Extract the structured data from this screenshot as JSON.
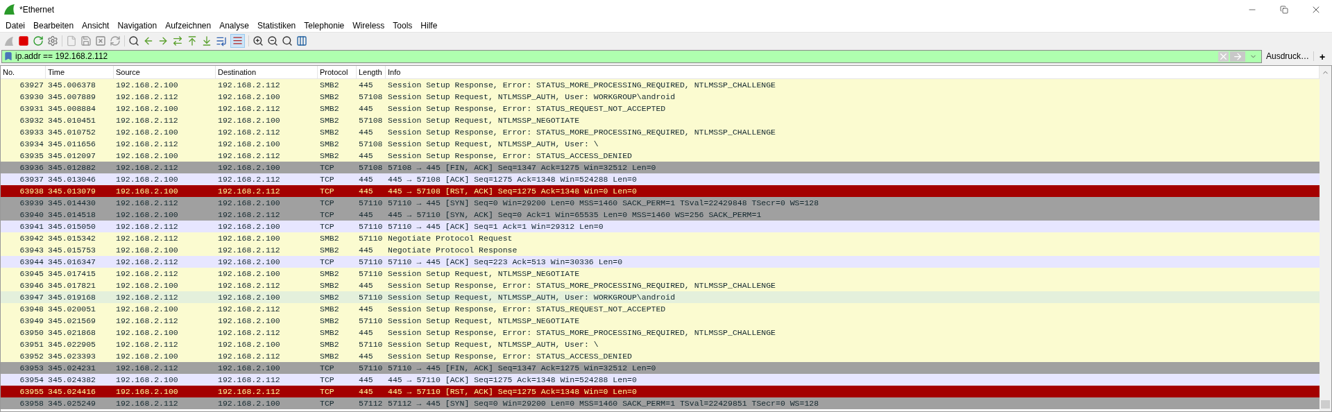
{
  "window": {
    "title": "*Ethernet"
  },
  "menu": [
    "Datei",
    "Bearbeiten",
    "Ansicht",
    "Navigation",
    "Aufzeichnen",
    "Analyse",
    "Statistiken",
    "Telephonie",
    "Wireless",
    "Tools",
    "Hilfe"
  ],
  "toolbar": {
    "coloring_on": true
  },
  "filter": {
    "value": "ip.addr == 192.168.2.112",
    "expression_button": "Ausdruck…",
    "add_button": "+"
  },
  "table": {
    "columns": [
      "No.",
      "Time",
      "Source",
      "Destination",
      "Protocol",
      "Length",
      "Info"
    ],
    "rows": [
      {
        "color": "#fbfbd0",
        "cells": [
          "63927",
          "345.006378",
          "192.168.2.100",
          "192.168.2.112",
          "SMB2",
          "445",
          "Session Setup Response, Error: STATUS_MORE_PROCESSING_REQUIRED, NTLMSSP_CHALLENGE"
        ]
      },
      {
        "color": "#fbfbd0",
        "cells": [
          "63930",
          "345.007889",
          "192.168.2.112",
          "192.168.2.100",
          "SMB2",
          "57108",
          "Session Setup Request, NTLMSSP_AUTH, User: WORKGROUP\\android"
        ]
      },
      {
        "color": "#fbfbd0",
        "cells": [
          "63931",
          "345.008884",
          "192.168.2.100",
          "192.168.2.112",
          "SMB2",
          "445",
          "Session Setup Response, Error: STATUS_REQUEST_NOT_ACCEPTED"
        ]
      },
      {
        "color": "#fbfbd0",
        "cells": [
          "63932",
          "345.010451",
          "192.168.2.112",
          "192.168.2.100",
          "SMB2",
          "57108",
          "Session Setup Request, NTLMSSP_NEGOTIATE"
        ]
      },
      {
        "color": "#fbfbd0",
        "cells": [
          "63933",
          "345.010752",
          "192.168.2.100",
          "192.168.2.112",
          "SMB2",
          "445",
          "Session Setup Response, Error: STATUS_MORE_PROCESSING_REQUIRED, NTLMSSP_CHALLENGE"
        ]
      },
      {
        "color": "#fbfbd0",
        "cells": [
          "63934",
          "345.011656",
          "192.168.2.112",
          "192.168.2.100",
          "SMB2",
          "57108",
          "Session Setup Request, NTLMSSP_AUTH, User: \\"
        ]
      },
      {
        "color": "#fbfbd0",
        "cells": [
          "63935",
          "345.012097",
          "192.168.2.100",
          "192.168.2.112",
          "SMB2",
          "445",
          "Session Setup Response, Error: STATUS_ACCESS_DENIED"
        ]
      },
      {
        "color": "#a0a0a0",
        "cells": [
          "63936",
          "345.012882",
          "192.168.2.112",
          "192.168.2.100",
          "TCP",
          "57108",
          "57108 → 445 [FIN, ACK] Seq=1347 Ack=1275 Win=32512 Len=0"
        ]
      },
      {
        "color": "#e7e6ff",
        "cells": [
          "63937",
          "345.013046",
          "192.168.2.100",
          "192.168.2.112",
          "TCP",
          "445",
          "445 → 57108 [ACK] Seq=1275 Ack=1348 Win=524288 Len=0"
        ]
      },
      {
        "color": "#a40000",
        "cells": [
          "63938",
          "345.013079",
          "192.168.2.100",
          "192.168.2.112",
          "TCP",
          "445",
          "445 → 57108 [RST, ACK] Seq=1275 Ack=1348 Win=0 Len=0"
        ]
      },
      {
        "color": "#a0a0a0",
        "cells": [
          "63939",
          "345.014430",
          "192.168.2.112",
          "192.168.2.100",
          "TCP",
          "57110",
          "57110 → 445 [SYN] Seq=0 Win=29200 Len=0 MSS=1460 SACK_PERM=1 TSval=22429848 TSecr=0 WS=128"
        ]
      },
      {
        "color": "#a0a0a0",
        "cells": [
          "63940",
          "345.014518",
          "192.168.2.100",
          "192.168.2.112",
          "TCP",
          "445",
          "445 → 57110 [SYN, ACK] Seq=0 Ack=1 Win=65535 Len=0 MSS=1460 WS=256 SACK_PERM=1"
        ]
      },
      {
        "color": "#e7e6ff",
        "cells": [
          "63941",
          "345.015050",
          "192.168.2.112",
          "192.168.2.100",
          "TCP",
          "57110",
          "57110 → 445 [ACK] Seq=1 Ack=1 Win=29312 Len=0"
        ]
      },
      {
        "color": "#fbfbd0",
        "cells": [
          "63942",
          "345.015342",
          "192.168.2.112",
          "192.168.2.100",
          "SMB2",
          "57110",
          "Negotiate Protocol Request"
        ]
      },
      {
        "color": "#fbfbd0",
        "cells": [
          "63943",
          "345.015753",
          "192.168.2.100",
          "192.168.2.112",
          "SMB2",
          "445",
          "Negotiate Protocol Response"
        ]
      },
      {
        "color": "#e7e6ff",
        "cells": [
          "63944",
          "345.016347",
          "192.168.2.112",
          "192.168.2.100",
          "TCP",
          "57110",
          "57110 → 445 [ACK] Seq=223 Ack=513 Win=30336 Len=0"
        ]
      },
      {
        "color": "#fbfbd0",
        "cells": [
          "63945",
          "345.017415",
          "192.168.2.112",
          "192.168.2.100",
          "SMB2",
          "57110",
          "Session Setup Request, NTLMSSP_NEGOTIATE"
        ]
      },
      {
        "color": "#fbfbd0",
        "cells": [
          "63946",
          "345.017821",
          "192.168.2.100",
          "192.168.2.112",
          "SMB2",
          "445",
          "Session Setup Response, Error: STATUS_MORE_PROCESSING_REQUIRED, NTLMSSP_CHALLENGE"
        ]
      },
      {
        "color": "#e4f0dc",
        "cells": [
          "63947",
          "345.019168",
          "192.168.2.112",
          "192.168.2.100",
          "SMB2",
          "57110",
          "Session Setup Request, NTLMSSP_AUTH, User: WORKGROUP\\android"
        ]
      },
      {
        "color": "#fbfbd0",
        "cells": [
          "63948",
          "345.020051",
          "192.168.2.100",
          "192.168.2.112",
          "SMB2",
          "445",
          "Session Setup Response, Error: STATUS_REQUEST_NOT_ACCEPTED"
        ]
      },
      {
        "color": "#fbfbd0",
        "cells": [
          "63949",
          "345.021569",
          "192.168.2.112",
          "192.168.2.100",
          "SMB2",
          "57110",
          "Session Setup Request, NTLMSSP_NEGOTIATE"
        ]
      },
      {
        "color": "#fbfbd0",
        "cells": [
          "63950",
          "345.021868",
          "192.168.2.100",
          "192.168.2.112",
          "SMB2",
          "445",
          "Session Setup Response, Error: STATUS_MORE_PROCESSING_REQUIRED, NTLMSSP_CHALLENGE"
        ]
      },
      {
        "color": "#fbfbd0",
        "cells": [
          "63951",
          "345.022905",
          "192.168.2.112",
          "192.168.2.100",
          "SMB2",
          "57110",
          "Session Setup Request, NTLMSSP_AUTH, User: \\"
        ]
      },
      {
        "color": "#fbfbd0",
        "cells": [
          "63952",
          "345.023393",
          "192.168.2.100",
          "192.168.2.112",
          "SMB2",
          "445",
          "Session Setup Response, Error: STATUS_ACCESS_DENIED"
        ]
      },
      {
        "color": "#a0a0a0",
        "cells": [
          "63953",
          "345.024231",
          "192.168.2.112",
          "192.168.2.100",
          "TCP",
          "57110",
          "57110 → 445 [FIN, ACK] Seq=1347 Ack=1275 Win=32512 Len=0"
        ]
      },
      {
        "color": "#e7e6ff",
        "cells": [
          "63954",
          "345.024382",
          "192.168.2.100",
          "192.168.2.112",
          "TCP",
          "445",
          "445 → 57110 [ACK] Seq=1275 Ack=1348 Win=524288 Len=0"
        ]
      },
      {
        "color": "#a40000",
        "cells": [
          "63955",
          "345.024416",
          "192.168.2.100",
          "192.168.2.112",
          "TCP",
          "445",
          "445 → 57110 [RST, ACK] Seq=1275 Ack=1348 Win=0 Len=0"
        ]
      },
      {
        "color": "#a0a0a0",
        "cells": [
          "63958",
          "345.025249",
          "192.168.2.112",
          "192.168.2.100",
          "TCP",
          "57112",
          "57112 → 445 [SYN] Seq=0 Win=29200 Len=0 MSS=1460 SACK_PERM=1 TSval=22429851 TSecr=0 WS=128"
        ]
      }
    ]
  }
}
